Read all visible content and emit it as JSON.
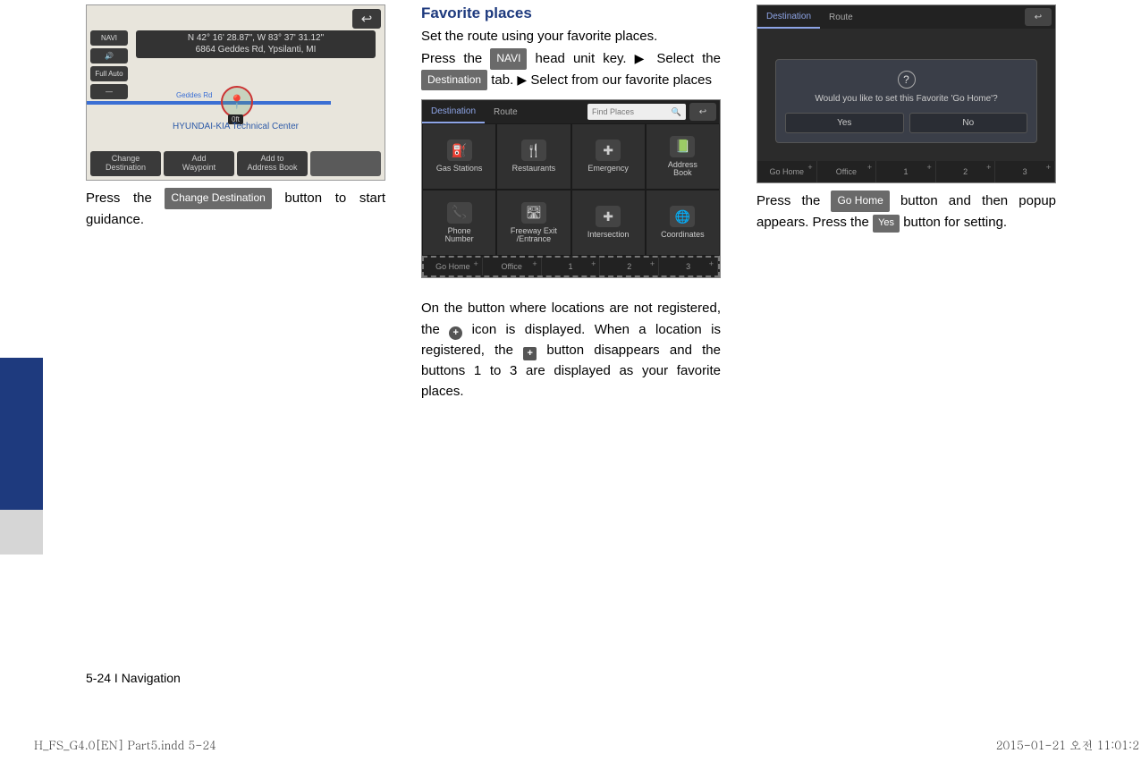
{
  "col1": {
    "map": {
      "coords": "N  42°  16' 28.87\", W  83°  37' 31.12\"",
      "addr": "6864 Geddes Rd, Ypsilanti, MI",
      "center_label": "HYUNDAI-KIA Technical Center",
      "dist": "0ft",
      "road": "Geddes Rd",
      "side": {
        "navi": "NAVI",
        "full": "Full Auto"
      },
      "btns": {
        "change": "Change\nDestination",
        "add_wp": "Add\nWaypoint",
        "add_ab": "Add to\nAddress Book"
      }
    },
    "text1a": "Press the ",
    "btn_change": "Change Destination",
    "text1b": " button to start guidance."
  },
  "col2": {
    "heading": "Favorite places",
    "p1": "Set the route using your favorite places.",
    "p2a": "Press the ",
    "btn_navi": "NAVI",
    "p2b": " head unit key. ",
    "p2c": " Select the ",
    "btn_dest": "Destination",
    "p2d": " tab. ",
    "p2e": " Select from our favorite places",
    "shot": {
      "tab_dest": "Destination",
      "tab_route": "Route",
      "search_ph": "Find Places",
      "cells": [
        "Gas Stations",
        "Restaurants",
        "Emergency",
        "Address\nBook",
        "Phone\nNumber",
        "Freeway Exit\n/Entrance",
        "Intersection",
        "Coordinates"
      ],
      "icons": [
        "⛽",
        "🍴",
        "✚",
        "📗",
        "📞",
        "🛣",
        "✚",
        "🌐"
      ],
      "fav": [
        "Go Home",
        "Office",
        "1",
        "2",
        "3"
      ]
    },
    "p3a": "On the button where locations are not registered, the ",
    "p3b": " icon is displayed. When a location is registered, the ",
    "p3c": " button disappears and the buttons 1 to 3 are displayed as your  favorite places."
  },
  "col3": {
    "shot": {
      "tab_dest": "Destination",
      "tab_route": "Route",
      "msg": "Would you like to set this Favorite 'Go Home'?",
      "yes": "Yes",
      "no": "No",
      "fav": [
        "Go Home",
        "Office",
        "1",
        "2",
        "3"
      ]
    },
    "p1a": "Press the ",
    "btn_gohome": "Go Home",
    "p1b": " button and then popup appears. Press the ",
    "btn_yes": "Yes",
    "p1c": " button for setting."
  },
  "footer": "5-24 I Navigation",
  "meta_left": "H_FS_G4.0[EN] Part5.indd   5-24",
  "meta_right": "2015-01-21   오전 11:01:2"
}
